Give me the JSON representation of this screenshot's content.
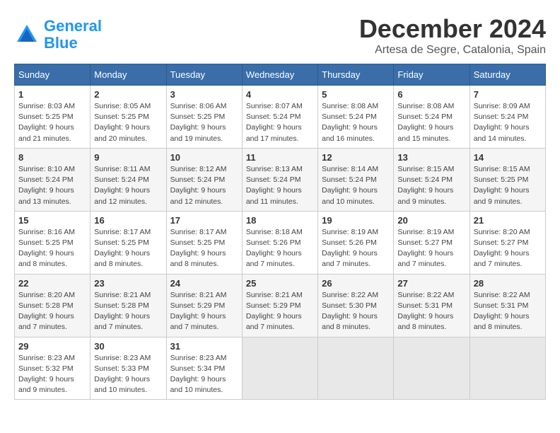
{
  "logo": {
    "line1": "General",
    "line2": "Blue"
  },
  "title": "December 2024",
  "location": "Artesa de Segre, Catalonia, Spain",
  "weekdays": [
    "Sunday",
    "Monday",
    "Tuesday",
    "Wednesday",
    "Thursday",
    "Friday",
    "Saturday"
  ],
  "weeks": [
    [
      {
        "day": "1",
        "sunrise": "8:03 AM",
        "sunset": "5:25 PM",
        "daylight": "9 hours and 21 minutes."
      },
      {
        "day": "2",
        "sunrise": "8:05 AM",
        "sunset": "5:25 PM",
        "daylight": "9 hours and 20 minutes."
      },
      {
        "day": "3",
        "sunrise": "8:06 AM",
        "sunset": "5:25 PM",
        "daylight": "9 hours and 19 minutes."
      },
      {
        "day": "4",
        "sunrise": "8:07 AM",
        "sunset": "5:24 PM",
        "daylight": "9 hours and 17 minutes."
      },
      {
        "day": "5",
        "sunrise": "8:08 AM",
        "sunset": "5:24 PM",
        "daylight": "9 hours and 16 minutes."
      },
      {
        "day": "6",
        "sunrise": "8:08 AM",
        "sunset": "5:24 PM",
        "daylight": "9 hours and 15 minutes."
      },
      {
        "day": "7",
        "sunrise": "8:09 AM",
        "sunset": "5:24 PM",
        "daylight": "9 hours and 14 minutes."
      }
    ],
    [
      {
        "day": "8",
        "sunrise": "8:10 AM",
        "sunset": "5:24 PM",
        "daylight": "9 hours and 13 minutes."
      },
      {
        "day": "9",
        "sunrise": "8:11 AM",
        "sunset": "5:24 PM",
        "daylight": "9 hours and 12 minutes."
      },
      {
        "day": "10",
        "sunrise": "8:12 AM",
        "sunset": "5:24 PM",
        "daylight": "9 hours and 12 minutes."
      },
      {
        "day": "11",
        "sunrise": "8:13 AM",
        "sunset": "5:24 PM",
        "daylight": "9 hours and 11 minutes."
      },
      {
        "day": "12",
        "sunrise": "8:14 AM",
        "sunset": "5:24 PM",
        "daylight": "9 hours and 10 minutes."
      },
      {
        "day": "13",
        "sunrise": "8:15 AM",
        "sunset": "5:24 PM",
        "daylight": "9 hours and 9 minutes."
      },
      {
        "day": "14",
        "sunrise": "8:15 AM",
        "sunset": "5:25 PM",
        "daylight": "9 hours and 9 minutes."
      }
    ],
    [
      {
        "day": "15",
        "sunrise": "8:16 AM",
        "sunset": "5:25 PM",
        "daylight": "9 hours and 8 minutes."
      },
      {
        "day": "16",
        "sunrise": "8:17 AM",
        "sunset": "5:25 PM",
        "daylight": "9 hours and 8 minutes."
      },
      {
        "day": "17",
        "sunrise": "8:17 AM",
        "sunset": "5:25 PM",
        "daylight": "9 hours and 8 minutes."
      },
      {
        "day": "18",
        "sunrise": "8:18 AM",
        "sunset": "5:26 PM",
        "daylight": "9 hours and 7 minutes."
      },
      {
        "day": "19",
        "sunrise": "8:19 AM",
        "sunset": "5:26 PM",
        "daylight": "9 hours and 7 minutes."
      },
      {
        "day": "20",
        "sunrise": "8:19 AM",
        "sunset": "5:27 PM",
        "daylight": "9 hours and 7 minutes."
      },
      {
        "day": "21",
        "sunrise": "8:20 AM",
        "sunset": "5:27 PM",
        "daylight": "9 hours and 7 minutes."
      }
    ],
    [
      {
        "day": "22",
        "sunrise": "8:20 AM",
        "sunset": "5:28 PM",
        "daylight": "9 hours and 7 minutes."
      },
      {
        "day": "23",
        "sunrise": "8:21 AM",
        "sunset": "5:28 PM",
        "daylight": "9 hours and 7 minutes."
      },
      {
        "day": "24",
        "sunrise": "8:21 AM",
        "sunset": "5:29 PM",
        "daylight": "9 hours and 7 minutes."
      },
      {
        "day": "25",
        "sunrise": "8:21 AM",
        "sunset": "5:29 PM",
        "daylight": "9 hours and 7 minutes."
      },
      {
        "day": "26",
        "sunrise": "8:22 AM",
        "sunset": "5:30 PM",
        "daylight": "9 hours and 8 minutes."
      },
      {
        "day": "27",
        "sunrise": "8:22 AM",
        "sunset": "5:31 PM",
        "daylight": "9 hours and 8 minutes."
      },
      {
        "day": "28",
        "sunrise": "8:22 AM",
        "sunset": "5:31 PM",
        "daylight": "9 hours and 8 minutes."
      }
    ],
    [
      {
        "day": "29",
        "sunrise": "8:23 AM",
        "sunset": "5:32 PM",
        "daylight": "9 hours and 9 minutes."
      },
      {
        "day": "30",
        "sunrise": "8:23 AM",
        "sunset": "5:33 PM",
        "daylight": "9 hours and 10 minutes."
      },
      {
        "day": "31",
        "sunrise": "8:23 AM",
        "sunset": "5:34 PM",
        "daylight": "9 hours and 10 minutes."
      },
      null,
      null,
      null,
      null
    ]
  ]
}
